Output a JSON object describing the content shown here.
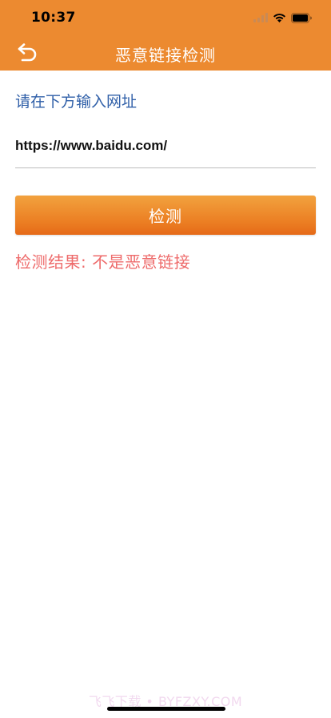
{
  "status_bar": {
    "time": "10:37"
  },
  "nav": {
    "title": "恶意链接检测",
    "back_icon": "back-arrow-icon"
  },
  "form": {
    "prompt": "请在下方输入网址",
    "url_value": "https://www.baidu.com/",
    "detect_button_label": "检测"
  },
  "result": {
    "text": "检测结果: 不是恶意链接"
  },
  "watermark": {
    "text": "飞飞下载 • BYFZXY.COM"
  },
  "colors": {
    "header_bg": "#ec8a30",
    "prompt_text": "#2f5fa8",
    "button_gradient_start": "#f2a23e",
    "button_gradient_end": "#e56a18",
    "result_text": "#ee6b6b"
  }
}
